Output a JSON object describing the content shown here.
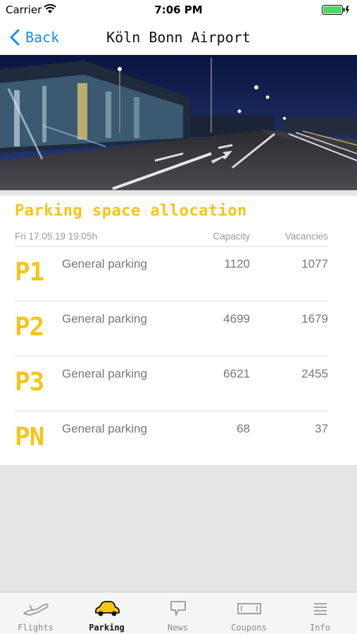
{
  "status_bar": {
    "carrier": "Carrier",
    "time": "7:06 PM"
  },
  "nav": {
    "back_label": "Back",
    "title": "Köln Bonn Airport"
  },
  "parking": {
    "title": "Parking space allocation",
    "timestamp": "Fri 17.05.19 19:05h",
    "capacity_header": "Capacity",
    "vacancies_header": "Vacancies",
    "rows": [
      {
        "code": "P1",
        "type": "General parking",
        "capacity": "1120",
        "vacancies": "1077"
      },
      {
        "code": "P2",
        "type": "General parking",
        "capacity": "4699",
        "vacancies": "1679"
      },
      {
        "code": "P3",
        "type": "General parking",
        "capacity": "6621",
        "vacancies": "2455"
      },
      {
        "code": "PN",
        "type": "General parking",
        "capacity": "68",
        "vacancies": "37"
      }
    ]
  },
  "tabs": [
    {
      "label": "Flights",
      "icon": "plane-icon"
    },
    {
      "label": "Parking",
      "icon": "car-icon",
      "active": true
    },
    {
      "label": "News",
      "icon": "speech-bubble-icon"
    },
    {
      "label": "Coupons",
      "icon": "coupon-icon"
    },
    {
      "label": "Info",
      "icon": "list-icon"
    }
  ],
  "colors": {
    "accent": "#f5c518",
    "link": "#1a8cf0",
    "battery": "#4cd964"
  }
}
